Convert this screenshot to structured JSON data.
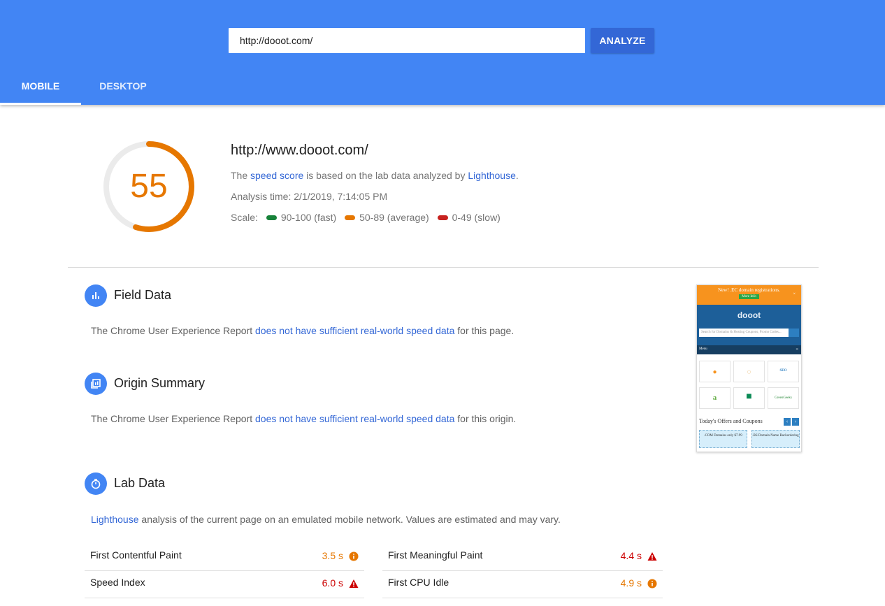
{
  "header": {
    "url_value": "http://dooot.com/",
    "analyze_label": "ANALYZE",
    "tabs": [
      {
        "label": "MOBILE",
        "active": true
      },
      {
        "label": "DESKTOP",
        "active": false
      }
    ]
  },
  "summary": {
    "score": "55",
    "score_color": "#e67700",
    "url": "http://www.dooot.com/",
    "desc_prefix": "The ",
    "desc_link1": "speed score",
    "desc_mid": " is based on the lab data analyzed by ",
    "desc_link2": "Lighthouse",
    "desc_suffix": ".",
    "analysis_time": "Analysis time: 2/1/2019, 7:14:05 PM",
    "scale_label": "Scale:",
    "scale": [
      {
        "label": "90-100 (fast)",
        "color": "#178239"
      },
      {
        "label": "50-89 (average)",
        "color": "#e67700"
      },
      {
        "label": "0-49 (slow)",
        "color": "#c7221f"
      }
    ]
  },
  "field_data": {
    "title": "Field Data",
    "text_prefix": "The Chrome User Experience Report ",
    "text_link": "does not have sufficient real-world speed data",
    "text_suffix": " for this page."
  },
  "origin_summary": {
    "title": "Origin Summary",
    "text_prefix": "The Chrome User Experience Report ",
    "text_link": "does not have sufficient real-world speed data",
    "text_suffix": " for this origin."
  },
  "lab_data": {
    "title": "Lab Data",
    "text_link": "Lighthouse",
    "text_suffix": " analysis of the current page on an emulated mobile network. Values are estimated and may vary.",
    "metrics": [
      {
        "label": "First Contentful Paint",
        "value": "3.5 s",
        "status": "average"
      },
      {
        "label": "First Meaningful Paint",
        "value": "4.4 s",
        "status": "slow"
      },
      {
        "label": "Speed Index",
        "value": "6.0 s",
        "status": "slow"
      },
      {
        "label": "First CPU Idle",
        "value": "4.9 s",
        "status": "average"
      }
    ]
  },
  "thumbnail": {
    "banner": "New! .EC domain registrations.",
    "banner_button": "More Info",
    "logo": "dooot",
    "search_placeholder": "Search for Domains & Hosting Coupons, Promo Codes...",
    "menu": "Menu",
    "tiles": [
      "",
      "",
      "SEO",
      "",
      "",
      "GreenGeeks"
    ],
    "offers_heading": "Today's Offers and Coupons",
    "coupon1": ".COM Domains only $7.99",
    "coupon2": ".RS Domain Name Backordering"
  }
}
